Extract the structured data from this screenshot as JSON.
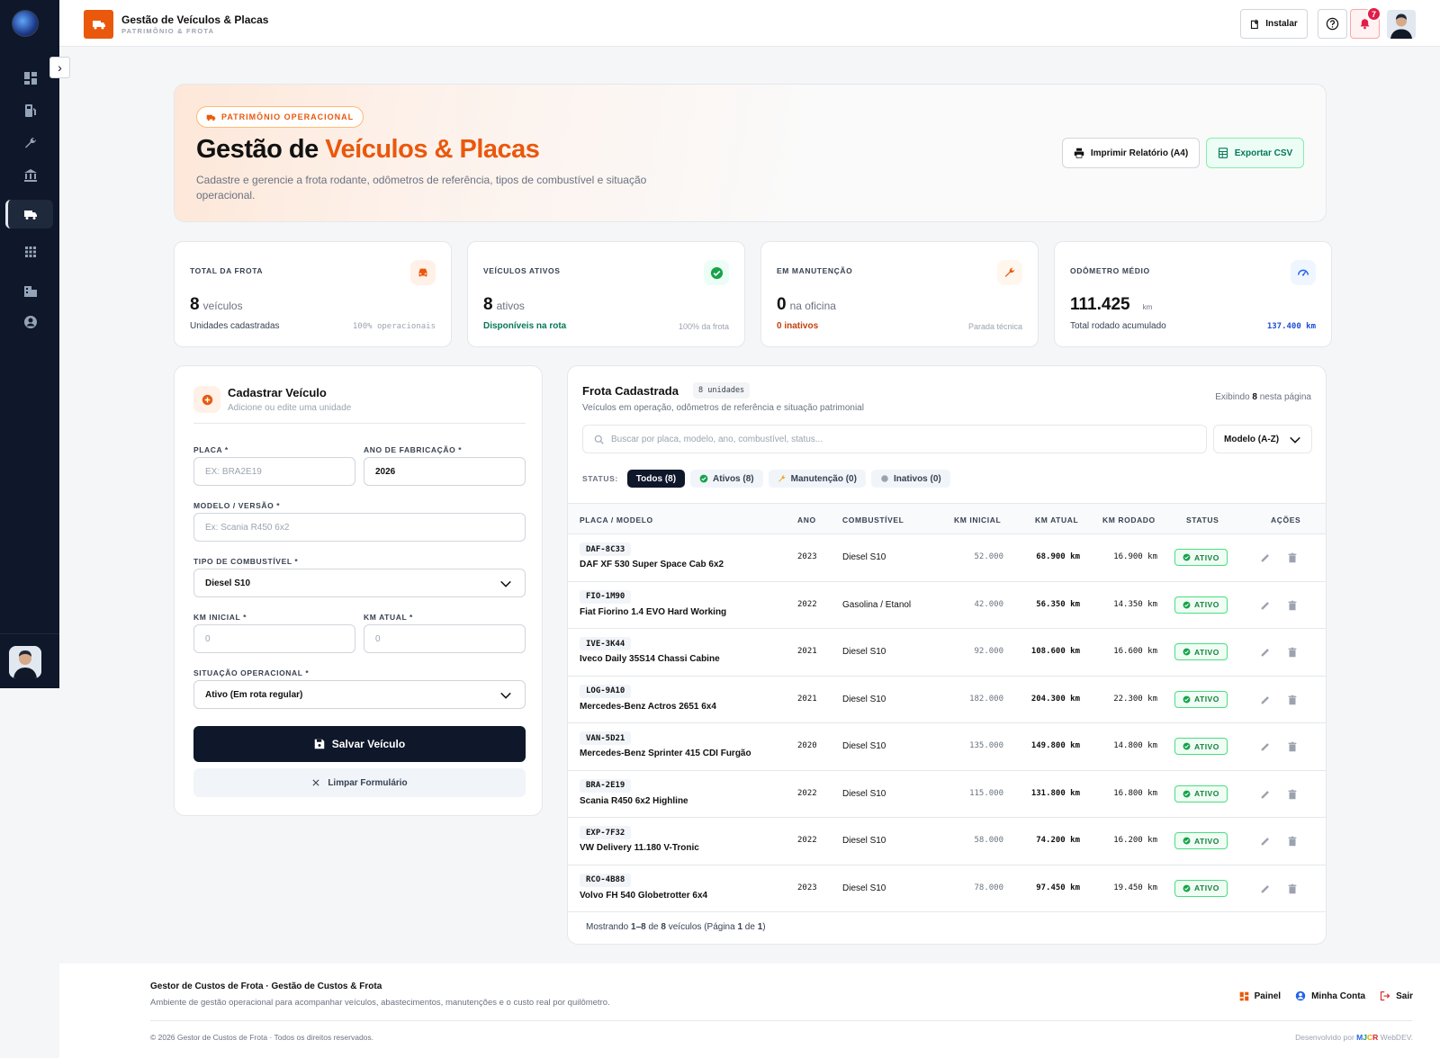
{
  "header": {
    "title": "Gestão de Veículos & Placas",
    "subtitle": "PATRIMÔNIO & FROTA",
    "install_label": "Instalar",
    "notification_count": "7"
  },
  "hero": {
    "pill": "PATRIMÔNIO OPERACIONAL",
    "title_a": "Gestão de ",
    "title_b": "Veículos & Placas",
    "description": "Cadastre e gerencie a frota rodante, odômetros de referência, tipos de combustível e situação operacional.",
    "print_label": "Imprimir Relatório (A4)",
    "export_label": "Exportar CSV"
  },
  "stats": [
    {
      "label": "TOTAL DA FROTA",
      "value": "8",
      "unit": "veículos",
      "sub": "Unidades cadastradas",
      "right": "100% operacionais",
      "sub_color": "#374151",
      "right_color": "#9ca3af",
      "icon": "car-icon",
      "icon_bg": "#fff1e7",
      "icon_color": "#ea580c"
    },
    {
      "label": "VEÍCULOS ATIVOS",
      "value": "8",
      "unit": "ativos",
      "sub": "Disponíveis na rota",
      "right": "100% da frota",
      "sub_color": "#047857",
      "right_color": "#9ca3af",
      "icon": "check-circle-icon",
      "icon_bg": "#ecfdf5",
      "icon_color": "#16a34a"
    },
    {
      "label": "EM MANUTENÇÃO",
      "value": "0",
      "unit": "na oficina",
      "sub": "0 inativos",
      "right": "Parada técnica",
      "sub_color": "#c2410c",
      "right_color": "#9ca3af",
      "icon": "wrench-icon",
      "icon_bg": "#fff7ed",
      "icon_color": "#ea580c"
    },
    {
      "label": "ODÔMETRO MÉDIO",
      "value": "111.425",
      "unit": "km",
      "sub": "Total rodado acumulado",
      "right": "137.400 km",
      "sub_color": "#374151",
      "right_color": "#1d4ed8",
      "icon": "gauge-icon",
      "icon_bg": "#eff6ff",
      "icon_color": "#2563eb"
    }
  ],
  "form": {
    "title": "Cadastrar Veículo",
    "subtitle": "Adicione ou edite uma unidade",
    "plate_label": "PLACA *",
    "plate_placeholder": "EX: BRA2E19",
    "year_label": "ANO DE FABRICAÇÃO *",
    "year_value": "2026",
    "model_label": "MODELO / VERSÃO *",
    "model_placeholder": "Ex: Scania R450 6x2",
    "fuel_label": "TIPO DE COMBUSTÍVEL *",
    "fuel_value": "Diesel S10",
    "km_start_label": "KM INICIAL *",
    "km_start_placeholder": "0",
    "km_current_label": "KM ATUAL *",
    "km_current_placeholder": "0",
    "status_label": "SITUAÇÃO OPERACIONAL *",
    "status_value": "Ativo (Em rota regular)",
    "save_label": "Salvar Veículo",
    "clear_label": "Limpar Formulário"
  },
  "fleet": {
    "title": "Frota Cadastrada",
    "count": "8 unidades",
    "subtitle": "Veículos em operação, odômetros de referência e situação patrimonial",
    "showing_prefix": "Exibindo ",
    "showing_count": "8",
    "showing_suffix": " nesta página",
    "search_placeholder": "Buscar por placa, modelo, ano, combustível, status...",
    "sort_value": "Modelo (A-Z)",
    "status_label": "STATUS:",
    "filters": [
      "Todos (8)",
      "Ativos (8)",
      "Manutenção (0)",
      "Inativos (0)"
    ],
    "columns": [
      "PLACA / MODELO",
      "ANO",
      "COMBUSTÍVEL",
      "KM INICIAL",
      "KM ATUAL",
      "KM RODADO",
      "STATUS",
      "AÇÕES"
    ],
    "rows": [
      {
        "plate": "DAF-8C33",
        "model": "DAF XF 530 Super Space Cab 6x2",
        "year": "2023",
        "fuel": "Diesel S10",
        "km_start": "52.000",
        "km_current": "68.900 km",
        "km_run": "16.900 km",
        "status": "ATIVO"
      },
      {
        "plate": "FIO-1M90",
        "model": "Fiat Fiorino 1.4 EVO Hard Working",
        "year": "2022",
        "fuel": "Gasolina / Etanol",
        "km_start": "42.000",
        "km_current": "56.350 km",
        "km_run": "14.350 km",
        "status": "ATIVO"
      },
      {
        "plate": "IVE-3K44",
        "model": "Iveco Daily 35S14 Chassi Cabine",
        "year": "2021",
        "fuel": "Diesel S10",
        "km_start": "92.000",
        "km_current": "108.600 km",
        "km_run": "16.600 km",
        "status": "ATIVO"
      },
      {
        "plate": "LOG-9A10",
        "model": "Mercedes-Benz Actros 2651 6x4",
        "year": "2021",
        "fuel": "Diesel S10",
        "km_start": "182.000",
        "km_current": "204.300 km",
        "km_run": "22.300 km",
        "status": "ATIVO"
      },
      {
        "plate": "VAN-5D21",
        "model": "Mercedes-Benz Sprinter 415 CDI Furgão",
        "year": "2020",
        "fuel": "Diesel S10",
        "km_start": "135.000",
        "km_current": "149.800 km",
        "km_run": "14.800 km",
        "status": "ATIVO"
      },
      {
        "plate": "BRA-2E19",
        "model": "Scania R450 6x2 Highline",
        "year": "2022",
        "fuel": "Diesel S10",
        "km_start": "115.000",
        "km_current": "131.800 km",
        "km_run": "16.800 km",
        "status": "ATIVO"
      },
      {
        "plate": "EXP-7F32",
        "model": "VW Delivery 11.180 V-Tronic",
        "year": "2022",
        "fuel": "Diesel S10",
        "km_start": "58.000",
        "km_current": "74.200 km",
        "km_run": "16.200 km",
        "status": "ATIVO"
      },
      {
        "plate": "RCO-4B88",
        "model": "Volvo FH 540 Globetrotter 6x4",
        "year": "2023",
        "fuel": "Diesel S10",
        "km_start": "78.000",
        "km_current": "97.450 km",
        "km_run": "19.450 km",
        "status": "ATIVO"
      }
    ],
    "footer_a": "Mostrando ",
    "footer_b": "1–8",
    "footer_c": " de ",
    "footer_d": "8",
    "footer_e": " veículos (Página ",
    "footer_f": "1",
    "footer_g": " de ",
    "footer_h": "1",
    "footer_i": ")"
  },
  "footer": {
    "title": "Gestor de Custos de Frota · Gestão de Custos & Frota",
    "description": "Ambiente de gestão operacional para acompanhar veículos, abastecimentos, manutenções e o custo real por quilômetro.",
    "links": [
      "Painel",
      "Minha Conta",
      "Sair"
    ],
    "copyright": "© 2026 Gestor de Custos de Frota · Todos os direitos reservados.",
    "dev_prefix": "Desenvolvido por ",
    "dev_m": "M",
    "dev_j": "J",
    "dev_c": "C",
    "dev_r": "R",
    "dev_suffix": " WebDEV."
  },
  "colors": {
    "accent": "#ea580c",
    "dark": "#0f172a",
    "success": "#16a34a"
  }
}
